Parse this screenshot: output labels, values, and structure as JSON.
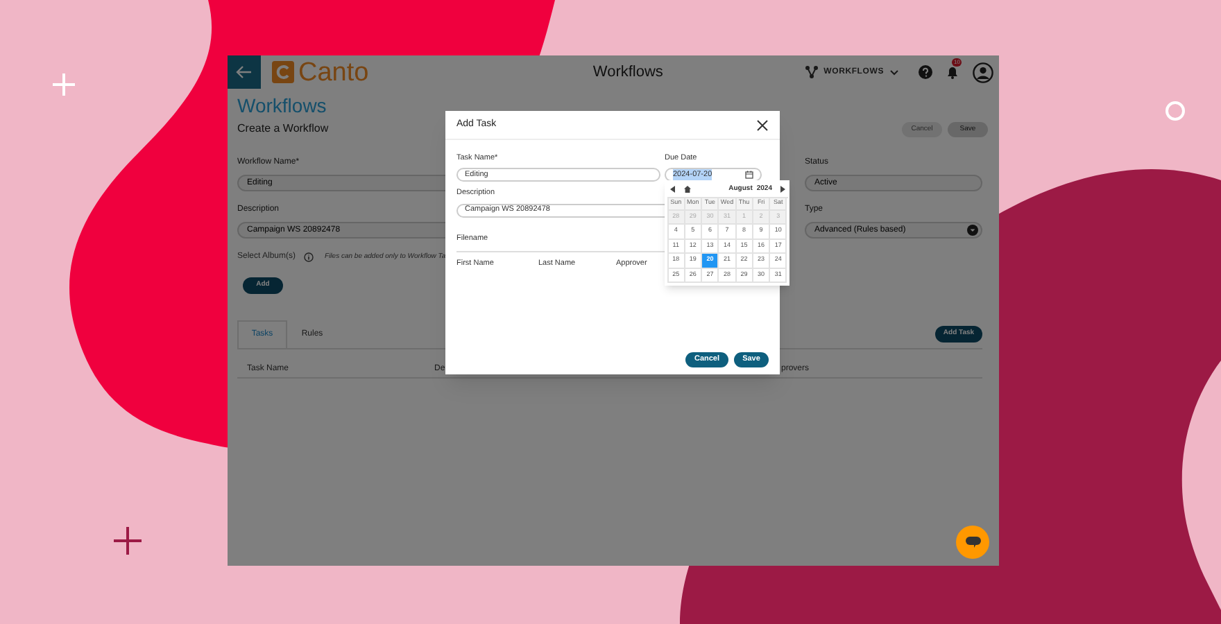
{
  "header": {
    "logo": "Canto",
    "title": "Workflows",
    "menu": "WORKFLOWS",
    "notification_count": "10"
  },
  "page": {
    "title": "Workflows",
    "subtitle": "Create a Workflow",
    "buttons": [
      "Cancel",
      "Save"
    ]
  },
  "left_fields": [
    {
      "label": "Workflow Name*",
      "value": "Editing"
    },
    {
      "label": "Description",
      "value": "Campaign WS 20892478"
    }
  ],
  "right_fields": [
    {
      "label": "Status",
      "value": "Active",
      "kind": "text"
    },
    {
      "label": "Type",
      "value": "Advanced (Rules based)",
      "kind": "select"
    }
  ],
  "album": {
    "label": "Select Album(s)",
    "note": "Files can be added only to Workflow Ta",
    "button": "Add"
  },
  "tabs": [
    {
      "label": "Tasks",
      "selected": true
    },
    {
      "label": "Rules",
      "selected": false
    }
  ],
  "add_task_button": "Add Task",
  "table": {
    "columns": [
      "Task Name",
      "De",
      "provers"
    ]
  },
  "modal": {
    "title": "Add Task",
    "task_name": {
      "label": "Task Name*",
      "value": "Editing"
    },
    "due_date": {
      "label": "Due Date",
      "value": "2024-07-20"
    },
    "description": {
      "label": "Description",
      "value": "Campaign WS 20892478"
    },
    "filename_label": "Filename",
    "columns": [
      "First Name",
      "Last Name",
      "Approver"
    ],
    "buttons": [
      "Cancel",
      "Save"
    ]
  },
  "calendar": {
    "month": "August",
    "year": "2024",
    "weekdays": [
      "Sun",
      "Mon",
      "Tue",
      "Wed",
      "Thu",
      "Fri",
      "Sat"
    ],
    "weeks": [
      [
        {
          "day": "28",
          "disabled": true,
          "selected": false
        },
        {
          "day": "29",
          "disabled": true,
          "selected": false
        },
        {
          "day": "30",
          "disabled": true,
          "selected": false
        },
        {
          "day": "31",
          "disabled": true,
          "selected": false
        },
        {
          "day": "1",
          "disabled": true,
          "selected": false
        },
        {
          "day": "2",
          "disabled": true,
          "selected": false
        },
        {
          "day": "3",
          "disabled": true,
          "selected": false
        }
      ],
      [
        {
          "day": "4",
          "disabled": false,
          "selected": false
        },
        {
          "day": "5",
          "disabled": false,
          "selected": false
        },
        {
          "day": "6",
          "disabled": false,
          "selected": false
        },
        {
          "day": "7",
          "disabled": false,
          "selected": false
        },
        {
          "day": "8",
          "disabled": false,
          "selected": false
        },
        {
          "day": "9",
          "disabled": false,
          "selected": false
        },
        {
          "day": "10",
          "disabled": false,
          "selected": false
        }
      ],
      [
        {
          "day": "11",
          "disabled": false,
          "selected": false
        },
        {
          "day": "12",
          "disabled": false,
          "selected": false
        },
        {
          "day": "13",
          "disabled": false,
          "selected": false
        },
        {
          "day": "14",
          "disabled": false,
          "selected": false
        },
        {
          "day": "15",
          "disabled": false,
          "selected": false
        },
        {
          "day": "16",
          "disabled": false,
          "selected": false
        },
        {
          "day": "17",
          "disabled": false,
          "selected": false
        }
      ],
      [
        {
          "day": "18",
          "disabled": false,
          "selected": false
        },
        {
          "day": "19",
          "disabled": false,
          "selected": false
        },
        {
          "day": "20",
          "disabled": false,
          "selected": true
        },
        {
          "day": "21",
          "disabled": false,
          "selected": false
        },
        {
          "day": "22",
          "disabled": false,
          "selected": false
        },
        {
          "day": "23",
          "disabled": false,
          "selected": false
        },
        {
          "day": "24",
          "disabled": false,
          "selected": false
        }
      ],
      [
        {
          "day": "25",
          "disabled": false,
          "selected": false
        },
        {
          "day": "26",
          "disabled": false,
          "selected": false
        },
        {
          "day": "27",
          "disabled": false,
          "selected": false
        },
        {
          "day": "28",
          "disabled": false,
          "selected": false
        },
        {
          "day": "29",
          "disabled": false,
          "selected": false
        },
        {
          "day": "30",
          "disabled": false,
          "selected": false
        },
        {
          "day": "31",
          "disabled": false,
          "selected": false
        }
      ]
    ]
  }
}
